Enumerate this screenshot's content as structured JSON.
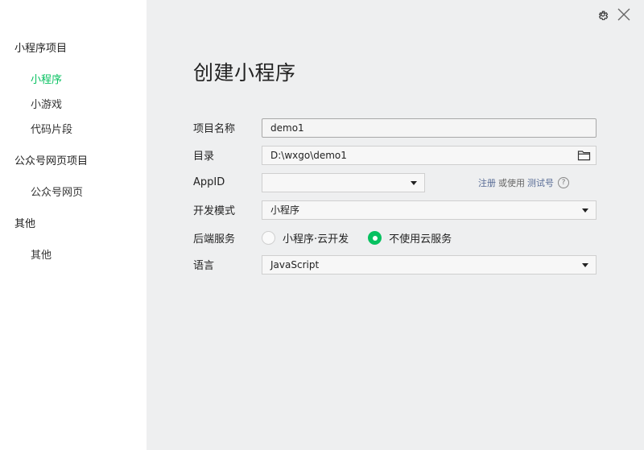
{
  "sidebar": {
    "categories": [
      {
        "label": "小程序项目"
      },
      {
        "label": "公众号网页项目"
      },
      {
        "label": "其他"
      }
    ],
    "items": [
      {
        "label": "小程序",
        "active": true
      },
      {
        "label": "小游戏"
      },
      {
        "label": "代码片段"
      },
      {
        "label": "公众号网页"
      },
      {
        "label": "其他"
      }
    ]
  },
  "main": {
    "title": "创建小程序",
    "form": {
      "project_name": {
        "label": "项目名称",
        "value": "demo1"
      },
      "directory": {
        "label": "目录",
        "value": "D:\\wxgo\\demo1"
      },
      "appid": {
        "label": "AppID",
        "value": "",
        "register_link": "注册",
        "or_use": "或使用",
        "test_link": "测试号",
        "help": "?"
      },
      "dev_mode": {
        "label": "开发模式",
        "value": "小程序"
      },
      "backend": {
        "label": "后端服务",
        "options": [
          {
            "label": "小程序·云开发",
            "checked": false
          },
          {
            "label": "不使用云服务",
            "checked": true
          }
        ]
      },
      "language": {
        "label": "语言",
        "value": "JavaScript"
      }
    }
  },
  "colors": {
    "accent": "#07c160",
    "link": "#576b95",
    "sidebar_bg": "#ffffff",
    "main_bg": "#eeeff0"
  },
  "icons": {
    "settings": "gear-icon",
    "close": "close-icon",
    "folder": "folder-icon",
    "dropdown": "chevron-down-icon",
    "help": "question-circle-icon"
  }
}
